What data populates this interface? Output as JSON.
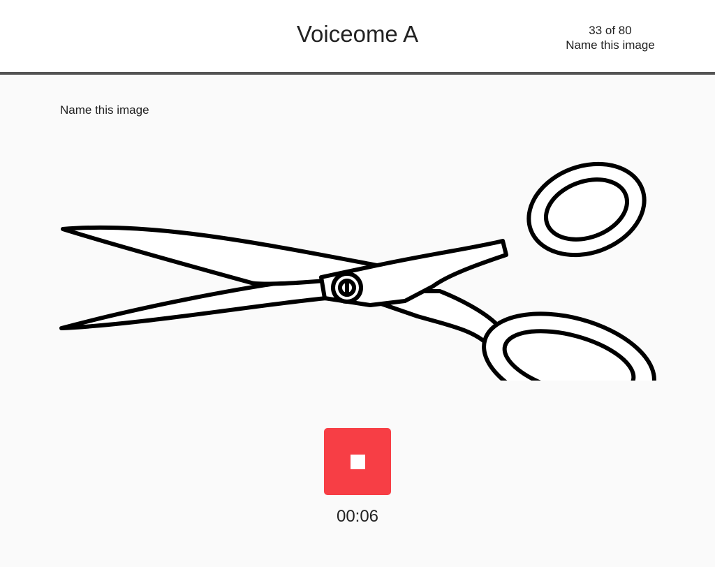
{
  "app": {
    "title": "Voiceome A"
  },
  "progress": {
    "counter": "33 of 80",
    "task_name": "Name this image"
  },
  "task": {
    "prompt": "Name this image",
    "stimulus_icon": "scissors-icon"
  },
  "recorder": {
    "state": "recording",
    "button_icon": "stop-icon",
    "button_color": "#f73e45",
    "elapsed": "00:06"
  }
}
